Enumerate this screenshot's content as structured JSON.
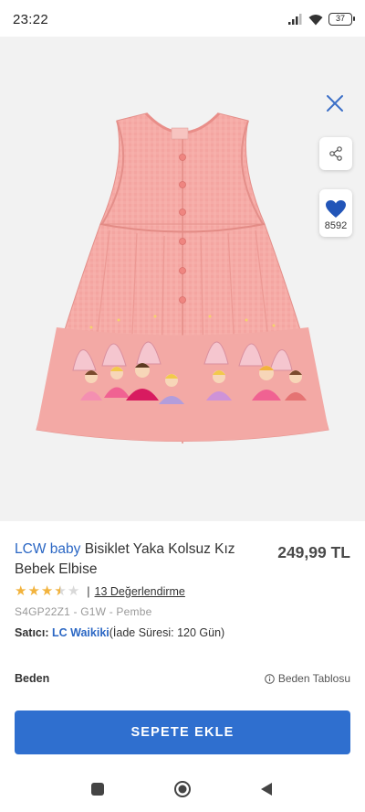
{
  "status_bar": {
    "time": "23:22",
    "battery": "37",
    "icons": [
      "signal-icon",
      "wifi-icon",
      "battery-icon"
    ]
  },
  "gallery": {
    "image_count": 2,
    "active_index": 0,
    "favorite_count": "8592"
  },
  "product": {
    "brand": "LCW baby",
    "name": "Bisiklet Yaka Kolsuz Kız Bebek Elbise",
    "price": "249,99 TL",
    "rating": 3.5,
    "reviews": "13 Değerlendirme",
    "sku": "S4GP22Z1 - G1W - Pembe",
    "seller_label": "Satıcı:",
    "seller": "LC Waikiki",
    "return_info": "(İade Süresi: 120 Gün)"
  },
  "size": {
    "label": "Beden",
    "chart_label": "Beden Tablosu"
  },
  "actions": {
    "add_to_cart": "SEPETE EKLE"
  },
  "colors": {
    "accent": "#2f6fcf",
    "brand": "#2b67c4",
    "heart": "#2255b8",
    "star": "#f2b33d",
    "dress": "#f4a3a0"
  }
}
